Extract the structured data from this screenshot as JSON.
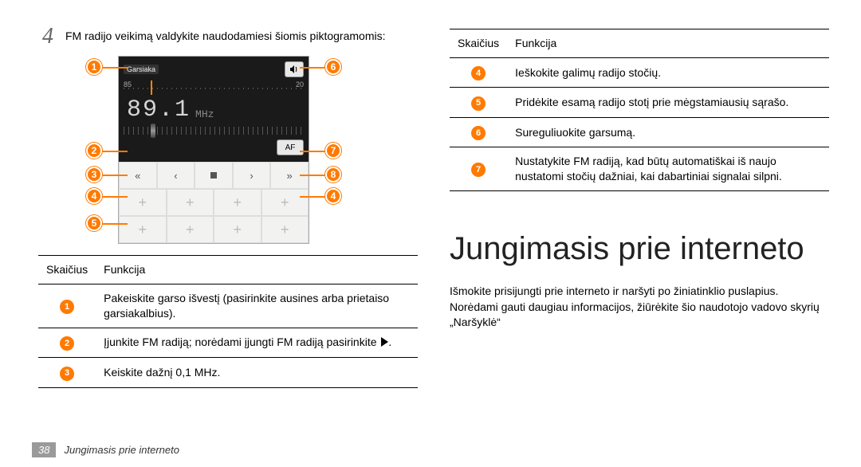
{
  "step": {
    "number": "4",
    "text": "FM radijo veikimą valdykite naudodamiesi šiomis piktogramomis:"
  },
  "radio": {
    "head_left": "Garsiaka",
    "scale_min": "85",
    "scale_max": "20",
    "freq_value": "89.1",
    "freq_unit": "MHz",
    "af_label": "AF",
    "controls": [
      "«",
      "‹",
      "■",
      "›",
      "»"
    ],
    "plus": "+"
  },
  "callouts_left": [
    "1",
    "2",
    "3",
    "4",
    "5"
  ],
  "callouts_right": [
    "6",
    "7",
    "8",
    "4"
  ],
  "table_headers": {
    "num": "Skaičius",
    "fn": "Funkcija"
  },
  "table_a": [
    {
      "n": "1",
      "t": "Pakeiskite garso išvestį (pasirinkite ausines arba prietaiso garsiakalbius)."
    },
    {
      "n": "2",
      "t": "Įjunkite FM radiją; norėdami įjungti FM radiją pasirinkite ",
      "play": true
    },
    {
      "n": "3",
      "t": "Keiskite dažnį 0,1 MHz."
    }
  ],
  "table_b": [
    {
      "n": "4",
      "t": "Ieškokite galimų radijo stočių."
    },
    {
      "n": "5",
      "t": "Pridėkite esamą radijo stotį prie mėgstamiausių sąrašo."
    },
    {
      "n": "6",
      "t": "Sureguliuokite garsumą."
    },
    {
      "n": "7",
      "t": "Nustatykite FM radiją, kad būtų automatiškai iš naujo nustatomi stočių dažniai, kai dabartiniai signalai silpni."
    }
  ],
  "heading": "Jungimasis prie interneto",
  "intro": "Išmokite prisijungti prie interneto ir naršyti po žiniatinklio puslapius. Norėdami gauti daugiau informacijos, žiūrėkite šio naudotojo vadovo skyrių „Naršyklė“",
  "footer": {
    "page": "38",
    "section": "Jungimasis prie interneto"
  }
}
